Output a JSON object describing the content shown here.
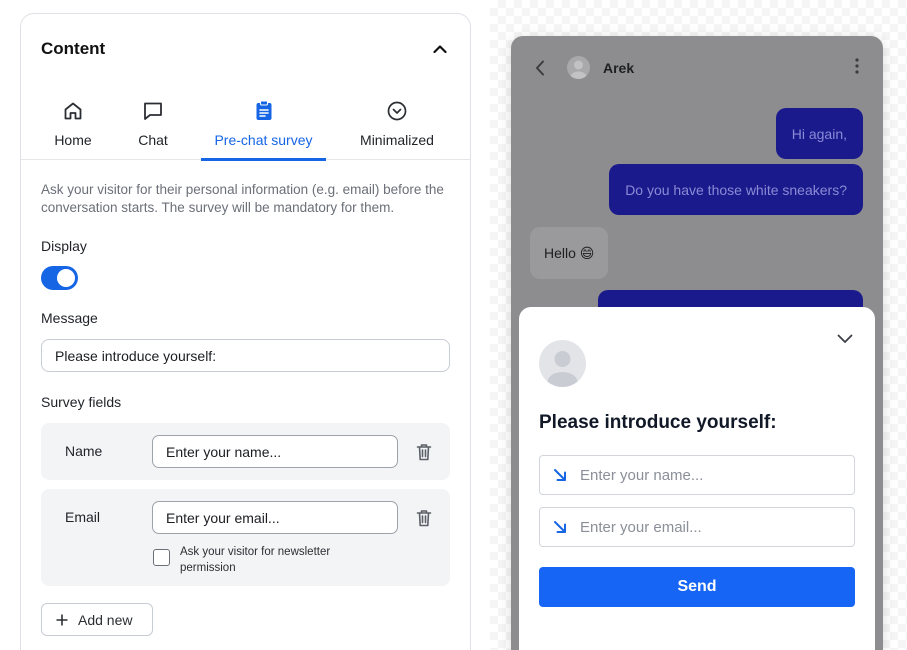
{
  "panel": {
    "title": "Content",
    "tabs": [
      {
        "label": "Home",
        "icon": "home-icon"
      },
      {
        "label": "Chat",
        "icon": "chat-icon"
      },
      {
        "label": "Pre-chat survey",
        "icon": "clipboard-icon",
        "active": true
      },
      {
        "label": "Minimalized",
        "icon": "chevron-circle-icon"
      }
    ],
    "description": "Ask your visitor for their personal information (e.g. email) before the conversation starts. The survey will be mandatory for them.",
    "display_label": "Display",
    "display_on": true,
    "message_label": "Message",
    "message_value": "Please introduce yourself:",
    "survey_fields_label": "Survey fields",
    "fields": [
      {
        "name": "Name",
        "placeholder": "Enter your name..."
      },
      {
        "name": "Email",
        "placeholder": "Enter your email..."
      }
    ],
    "newsletter_label": "Ask your visitor for newsletter permission",
    "add_new_label": "Add new"
  },
  "preview": {
    "agent_name": "Arek",
    "messages": [
      {
        "from": "visitor",
        "text": "Hi again,"
      },
      {
        "from": "visitor",
        "text": "Do you have those white sneakers?"
      },
      {
        "from": "agent",
        "text": "Hello 😄"
      }
    ],
    "survey": {
      "title": "Please introduce yourself:",
      "name_placeholder": "Enter your name...",
      "email_placeholder": "Enter your email...",
      "send_label": "Send"
    }
  },
  "colors": {
    "accent": "#1665e5",
    "send_button": "#1665f5",
    "visitor_bubble": "#1a1a8c"
  }
}
